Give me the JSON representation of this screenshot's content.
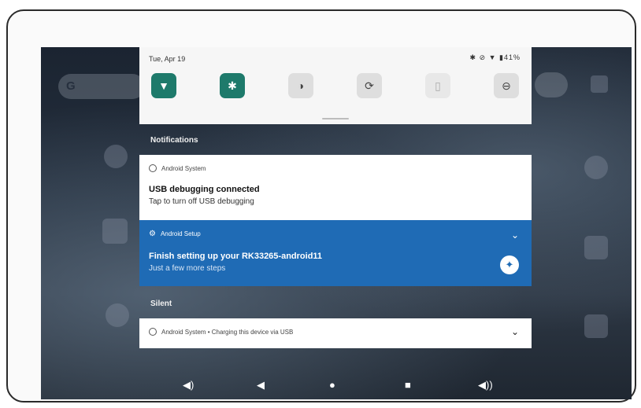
{
  "status_bar": {
    "date": "Tue, Apr 19",
    "battery": "41%"
  },
  "quick_tiles": [
    {
      "name": "wifi-tile",
      "icon": "▼",
      "state": "on"
    },
    {
      "name": "bluetooth-tile",
      "icon": "✱",
      "state": "on"
    },
    {
      "name": "invert-colors-tile",
      "icon": "◑",
      "state": "off"
    },
    {
      "name": "auto-rotate-tile",
      "icon": "⟳",
      "state": "off"
    },
    {
      "name": "battery-saver-tile",
      "icon": "▯",
      "state": "dim"
    },
    {
      "name": "do-not-disturb-tile",
      "icon": "⊖",
      "state": "off"
    }
  ],
  "launcher": {
    "search_letter": "G"
  },
  "sections": {
    "notifications": "Notifications",
    "silent": "Silent"
  },
  "notifications": [
    {
      "app": "Android System",
      "title": "USB debugging connected",
      "text": "Tap to turn off USB debugging"
    },
    {
      "app": "Android Setup",
      "title": "Finish setting up your RK33265-android11",
      "text": "Just a few more steps"
    }
  ],
  "silent_notification": {
    "app": "Android System • Charging this device via USB"
  },
  "nav_bar": {
    "vol_down": "◀)",
    "back": "◀",
    "home": "●",
    "recents": "■",
    "vol_up": "◀))"
  }
}
